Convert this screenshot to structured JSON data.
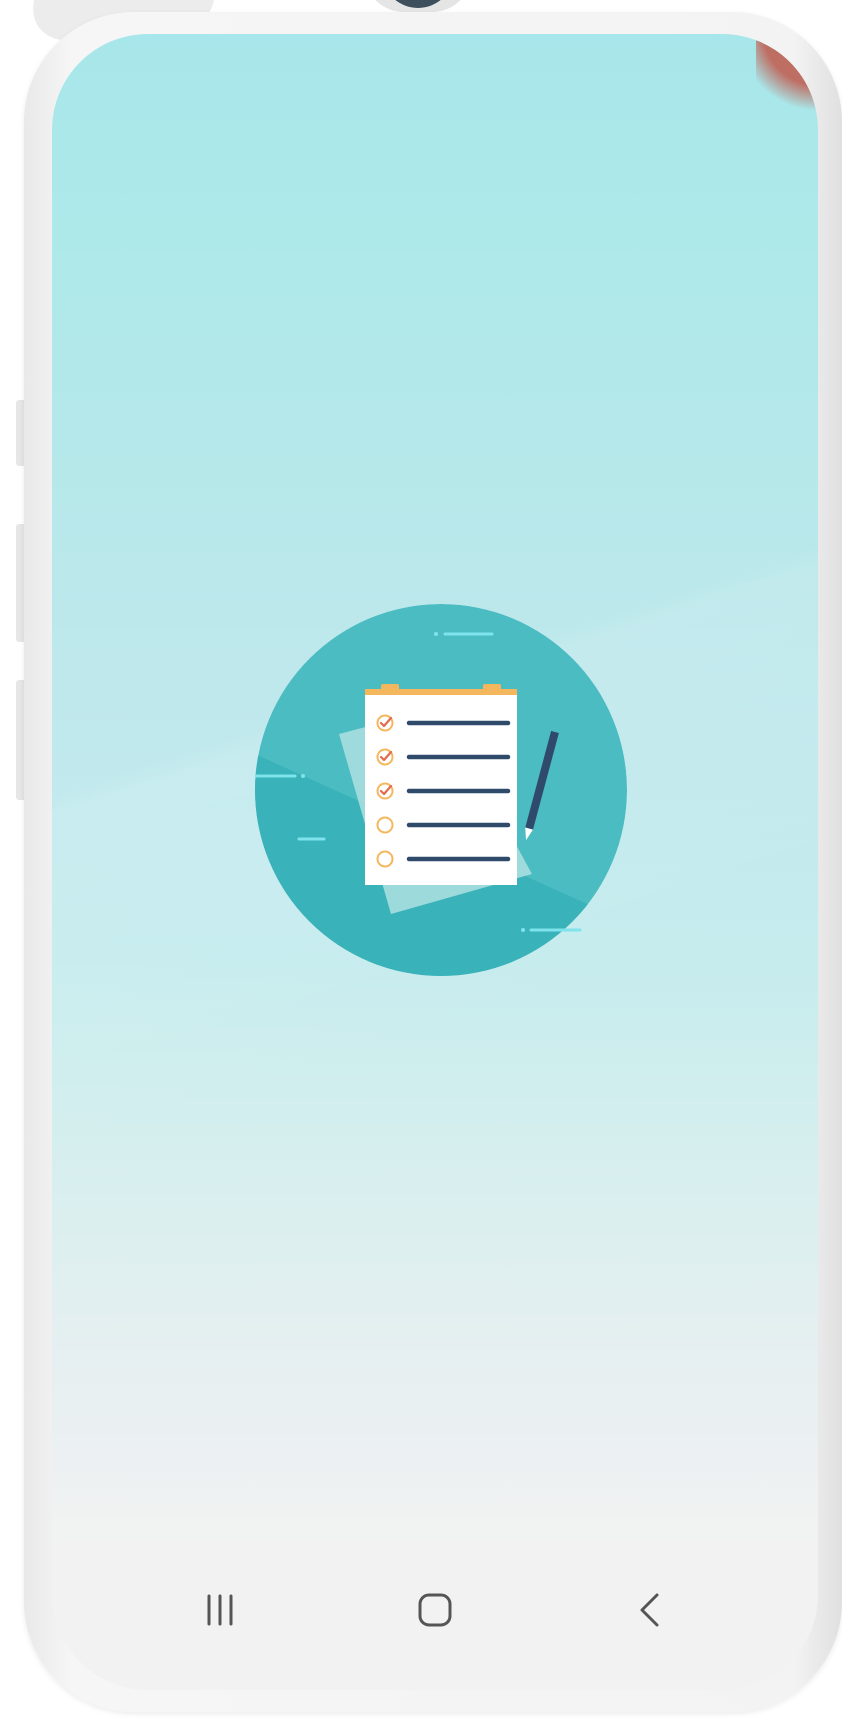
{
  "device": {
    "frame_color": "#f3f3f3",
    "camera_color": "#3d4f5c"
  },
  "splash": {
    "background_gradient": [
      "#a7e6ea",
      "#c6ecee",
      "#f3f3f3"
    ],
    "illustration": {
      "icon": "checklist-clipboard-icon",
      "circle_color": "#4bbcc2",
      "circle_shadow_color": "#3ab2b9",
      "paper_color": "#ffffff",
      "clip_color": "#f5b75d",
      "line_color": "#2f4a6b",
      "check_color": "#e46a4f",
      "checklist": [
        {
          "checked": true
        },
        {
          "checked": true
        },
        {
          "checked": true
        },
        {
          "checked": false
        },
        {
          "checked": false
        }
      ],
      "pencil_icon": "pencil-icon"
    }
  },
  "navigation_bar": {
    "background": "#f2f2f2",
    "buttons": [
      {
        "name": "recents",
        "icon": "recents-icon"
      },
      {
        "name": "home",
        "icon": "home-icon"
      },
      {
        "name": "back",
        "icon": "back-chevron-icon"
      }
    ],
    "icon_color": "#555555"
  }
}
